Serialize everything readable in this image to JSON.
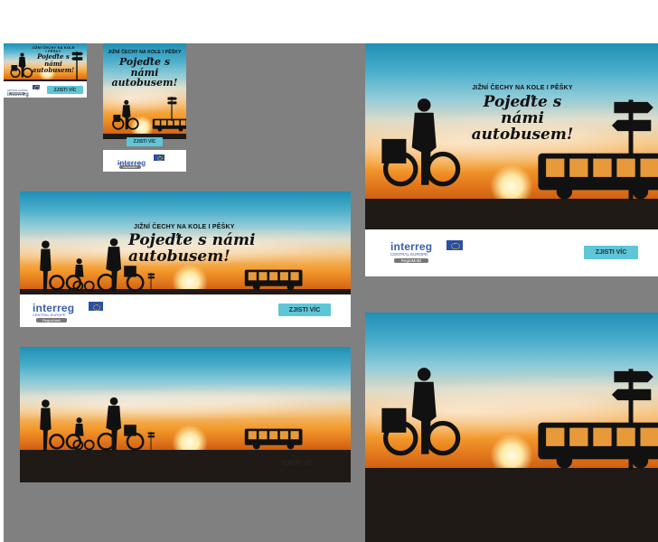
{
  "banners": {
    "subtitle": "JIŽNÍ ČECHY NA KOLE I PĚŠKY",
    "headline_wide": "Pojeďte s námi autobusem!",
    "headline_line1": "Pojeďte s námi",
    "headline_line2": "autobusem!",
    "cta": "ZJISTI VÍC",
    "logo_word": "interreg",
    "logo_region": "CENTRAL EUROPE",
    "logo_project": "RegioMobil"
  },
  "colors": {
    "canvas": "#808080",
    "button": "#5ec6d6",
    "logo_blue": "#3a5fa8"
  }
}
